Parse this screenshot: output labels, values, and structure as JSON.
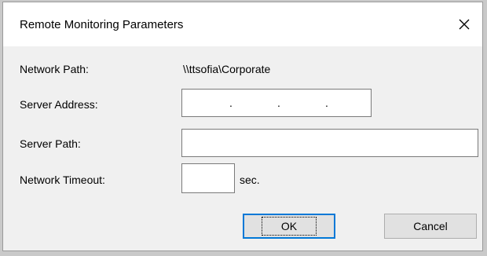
{
  "dialog": {
    "title": "Remote Monitoring Parameters",
    "close_icon": "close-icon"
  },
  "form": {
    "network_path": {
      "label": "Network Path:",
      "value": "\\\\ttsofia\\Corporate"
    },
    "server_address": {
      "label": "Server Address:",
      "value": "",
      "dots": [
        ".",
        ".",
        "."
      ]
    },
    "server_path": {
      "label": "Server Path:",
      "value": ""
    },
    "network_timeout": {
      "label": "Network Timeout:",
      "value": "",
      "unit": "sec."
    }
  },
  "buttons": {
    "ok": "OK",
    "cancel": "Cancel"
  },
  "colors": {
    "focus_border": "#0078d7",
    "dialog_bg": "#f0f0f0"
  }
}
